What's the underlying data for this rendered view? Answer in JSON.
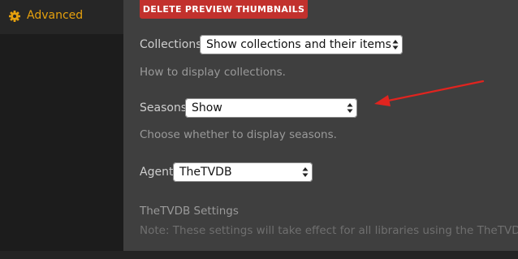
{
  "sidebar": {
    "items": [
      {
        "label": "Advanced",
        "icon": "gear-icon",
        "active": true
      }
    ],
    "accent": "#e5a00d"
  },
  "main": {
    "delete_thumbnails_button": "DELETE PREVIEW THUMBNAILS",
    "collections": {
      "label": "Collections",
      "value": "Show collections and their items",
      "help": "How to display collections."
    },
    "seasons": {
      "label": "Seasons",
      "value": "Show",
      "help": "Choose whether to display seasons."
    },
    "agent": {
      "label": "Agent",
      "value": "TheTVDB"
    },
    "agent_settings": {
      "title": "TheTVDB Settings",
      "note": "Note: These settings will take effect for all libraries using the TheTVDB ag"
    }
  },
  "annotation": {
    "type": "red-arrow",
    "color": "#e0241f",
    "points_to": "seasons-select"
  }
}
